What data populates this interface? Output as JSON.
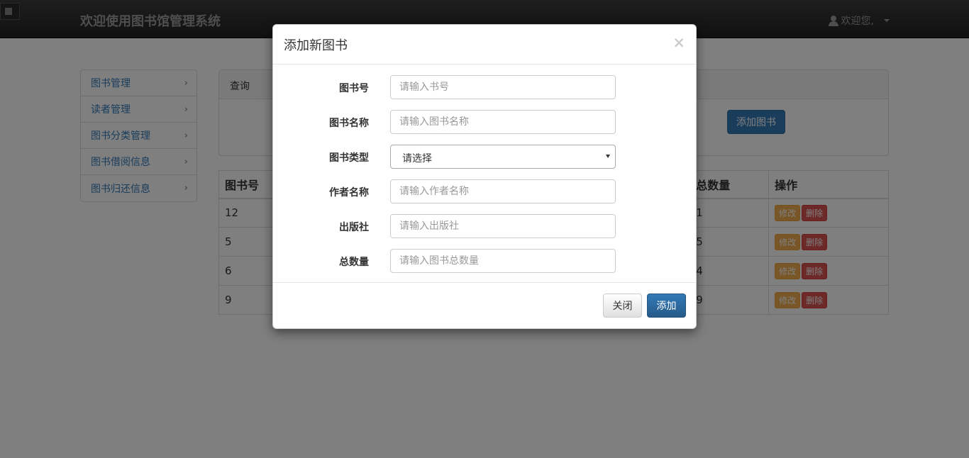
{
  "navbar": {
    "brand": "欢迎使用图书馆管理系统",
    "user_label": "欢迎您,"
  },
  "sidebar": {
    "items": [
      {
        "label": "图书管理"
      },
      {
        "label": "读者管理"
      },
      {
        "label": "图书分类管理"
      },
      {
        "label": "图书借阅信息"
      },
      {
        "label": "图书归还信息"
      }
    ]
  },
  "query_panel": {
    "heading": "查询",
    "add_button": "添加图书"
  },
  "table": {
    "headers": [
      "图书号",
      "总数量",
      "操作"
    ],
    "rows": [
      {
        "id": "12",
        "total": "1"
      },
      {
        "id": "5",
        "total": "5"
      },
      {
        "id": "6",
        "total": "4"
      },
      {
        "id": "9",
        "total": "9"
      }
    ],
    "edit_label": "修改",
    "delete_label": "删除"
  },
  "modal": {
    "title": "添加新图书",
    "close_symbol": "×",
    "fields": {
      "book_no": {
        "label": "图书号",
        "placeholder": "请输入书号"
      },
      "book_name": {
        "label": "图书名称",
        "placeholder": "请输入图书名称"
      },
      "book_type": {
        "label": "图书类型",
        "selected": "请选择"
      },
      "author": {
        "label": "作者名称",
        "placeholder": "请输入作者名称"
      },
      "publisher": {
        "label": "出版社",
        "placeholder": "请输入出版社"
      },
      "total": {
        "label": "总数量",
        "placeholder": "请输入图书总数量"
      }
    },
    "close_button": "关闭",
    "submit_button": "添加"
  },
  "colors": {
    "primary": "#337ab7",
    "warning": "#f0ad4e",
    "danger": "#d9534f",
    "navbar": "#222222"
  }
}
